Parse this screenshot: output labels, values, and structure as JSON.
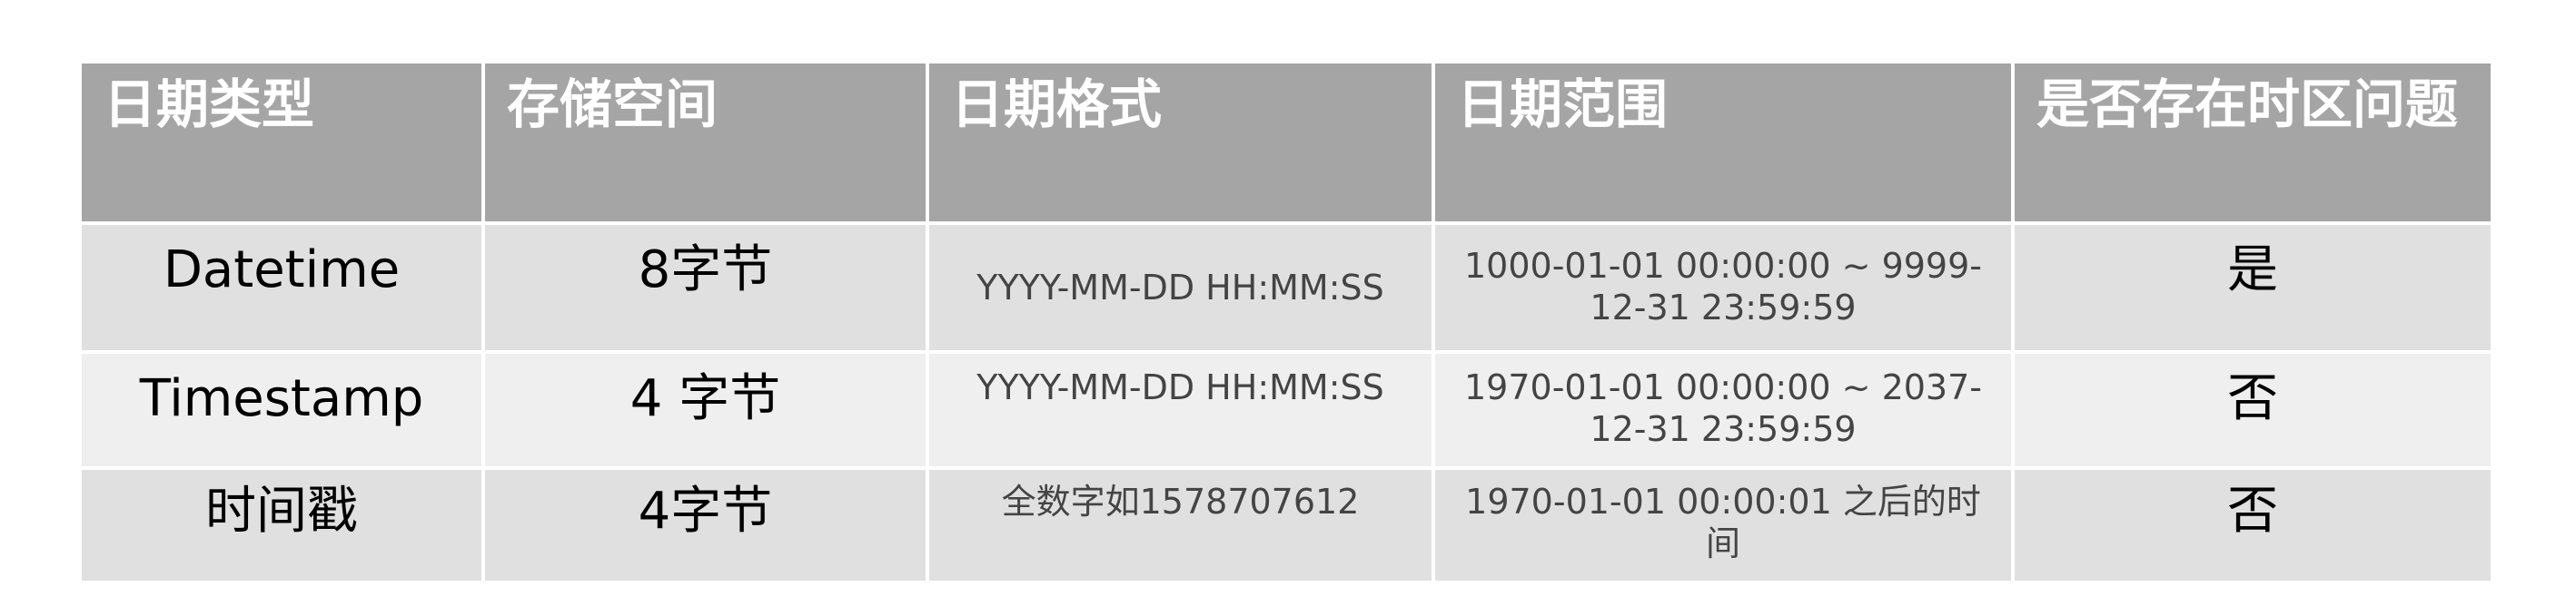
{
  "table": {
    "headers": [
      "日期类型",
      "存储空间",
      "日期格式",
      "日期范围",
      "是否存在时区问题"
    ],
    "rows": [
      [
        "Datetime",
        "8字节",
        "YYYY-MM-DD HH:MM:SS",
        "1000-01-01 00:00:00 ~ 9999-12-31 23:59:59",
        "是"
      ],
      [
        "Timestamp",
        "4 字节",
        "YYYY-MM-DD HH:MM:SS",
        "1970-01-01 00:00:00 ~ 2037-12-31 23:59:59",
        "否"
      ],
      [
        "时间戳",
        "4字节",
        "全数字如1578707612",
        "1970-01-01 00:00:01 之后的时间",
        "否"
      ]
    ]
  },
  "colors": {
    "header_bg": "#a5a5a5",
    "header_text": "#ffffff",
    "row_dark": "#e0e0e0",
    "row_light": "#efefef",
    "cell_text": "#000000",
    "small_text": "#444444"
  }
}
